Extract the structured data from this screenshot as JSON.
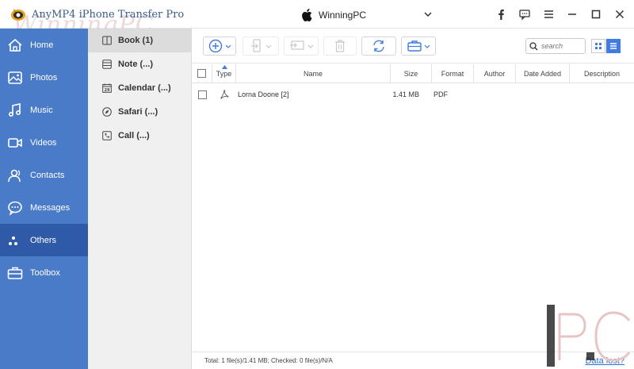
{
  "app": {
    "title": "AnyMP4 iPhone Transfer Pro",
    "watermark_text": "WinningPC"
  },
  "device": {
    "name": "WinningPC"
  },
  "window_buttons": [
    {
      "name": "facebook-button",
      "icon": "facebook-icon"
    },
    {
      "name": "feedback-button",
      "icon": "chat-icon"
    },
    {
      "name": "menu-button",
      "icon": "hamburger-menu-icon"
    },
    {
      "name": "minimize-button",
      "icon": "minimize-icon"
    },
    {
      "name": "maximize-button",
      "icon": "maximize-icon"
    },
    {
      "name": "close-button",
      "icon": "close-icon"
    }
  ],
  "sidebar": {
    "items": [
      {
        "label": "Home",
        "icon": "home-icon"
      },
      {
        "label": "Photos",
        "icon": "photos-icon"
      },
      {
        "label": "Music",
        "icon": "music-note-icon"
      },
      {
        "label": "Videos",
        "icon": "video-camera-icon"
      },
      {
        "label": "Contacts",
        "icon": "contacts-icon"
      },
      {
        "label": "Messages",
        "icon": "message-bubble-icon"
      },
      {
        "label": "Others",
        "icon": "more-dots-icon",
        "active": true
      },
      {
        "label": "Toolbox",
        "icon": "toolbox-icon"
      }
    ]
  },
  "subpanel": {
    "items": [
      {
        "label": "Book (1)",
        "icon": "book-icon",
        "active": true
      },
      {
        "label": "Note (...)",
        "icon": "note-icon"
      },
      {
        "label": "Calendar (...)",
        "icon": "calendar-icon"
      },
      {
        "label": "Safari (...)",
        "icon": "compass-icon"
      },
      {
        "label": "Call (...)",
        "icon": "phone-icon"
      }
    ]
  },
  "toolbar": {
    "search_placeholder": "search",
    "buttons": [
      "add-icon",
      "export-to-device-icon",
      "export-to-pc-icon",
      "delete-icon",
      "sync-icon",
      "toolbox-icon"
    ]
  },
  "table": {
    "columns": [
      "Type",
      "Name",
      "Size",
      "Format",
      "Author",
      "Date Added",
      "Description"
    ],
    "rows": [
      {
        "type_icon": "pdf-icon",
        "name": "Lorna Doone [2]",
        "size": "1.41 MB",
        "format": "PDF",
        "author": "",
        "date_added": "",
        "description": ""
      }
    ]
  },
  "status": {
    "summary": "Total: 1 file(s)/1.41 MB; Checked: 0 file(s)/N/A",
    "data_lost_link": "Data lost?"
  },
  "colors": {
    "sidebar": "#4a7bc8",
    "sidebar_active": "#2e5aa8",
    "accent": "#3f7be0",
    "link": "#2f6fd0"
  }
}
